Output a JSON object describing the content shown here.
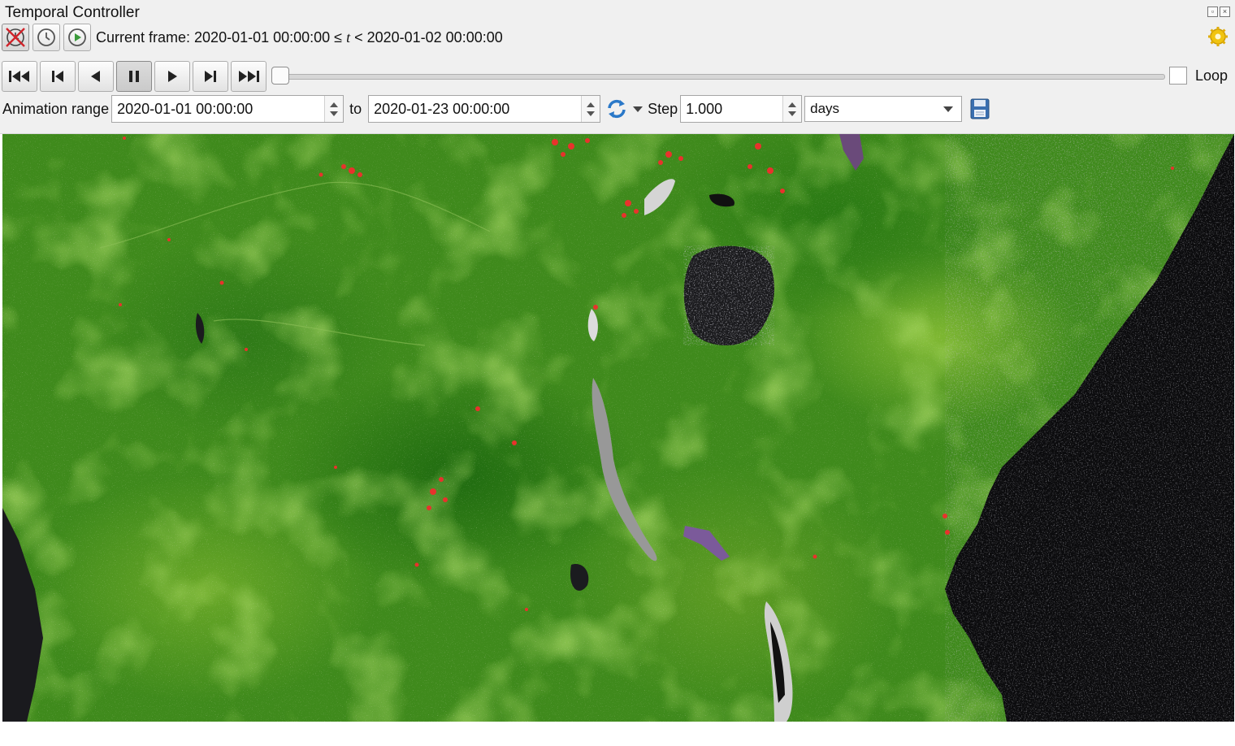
{
  "window": {
    "title": "Temporal Controller",
    "float_button_icon": "float-icon",
    "close_button_icon": "close-icon"
  },
  "mode": {
    "buttons": [
      {
        "name": "disable-temporal-navigation-button",
        "icon": "crossed-clock-icon",
        "active": true
      },
      {
        "name": "fixed-range-button",
        "icon": "clock-icon",
        "active": false
      },
      {
        "name": "animated-navigation-button",
        "icon": "play-circle-icon",
        "active": false
      }
    ],
    "current_frame_prefix": "Current frame: 2020-01-01 00:00:00 ≤ ",
    "current_frame_var": "t",
    "current_frame_suffix": " < 2020-01-02 00:00:00",
    "settings_icon": "gear-icon"
  },
  "navigation": {
    "buttons": [
      "rewind-to-start",
      "previous-frame",
      "play-backward",
      "pause",
      "play-forward",
      "next-frame",
      "skip-to-end"
    ],
    "active": "pause",
    "slider_position": 0,
    "loop_label": "Loop",
    "loop_checked": false
  },
  "range": {
    "label": "Animation range",
    "start": "2020-01-01 00:00:00",
    "to_label": "to",
    "end": "2020-01-23 00:00:00",
    "refresh_icon": "refresh-icon",
    "step_label": "Step",
    "step_value": "1.000",
    "step_unit": "days",
    "export_icon": "save-icon"
  },
  "colors": {
    "accent_green": "#3f8a1c",
    "fire_red": "#e8322c",
    "water_black": "#0b0b0d"
  }
}
